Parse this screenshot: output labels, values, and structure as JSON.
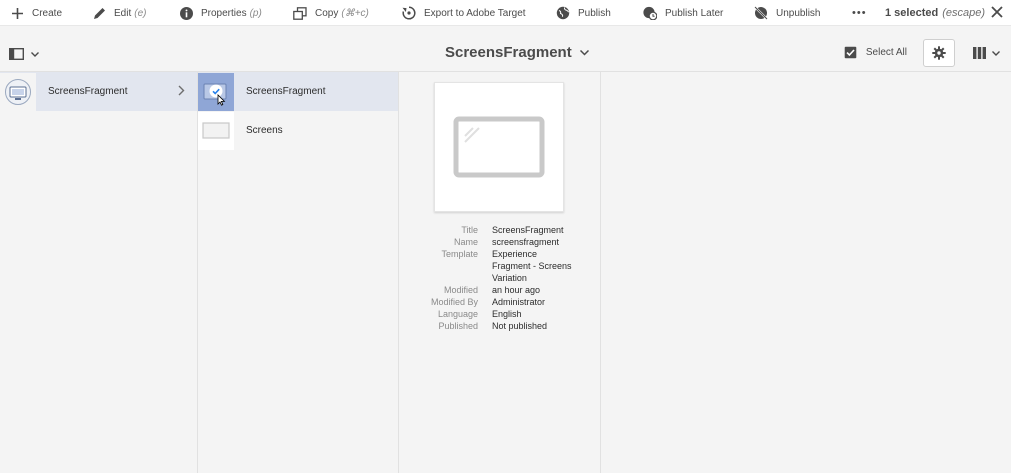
{
  "actionbar": {
    "create": "Create",
    "edit": "Edit",
    "edit_shortcut": "(e)",
    "properties": "Properties",
    "properties_shortcut": "(p)",
    "copy": "Copy",
    "copy_shortcut": "(⌘+c)",
    "export": "Export to Adobe Target",
    "publish": "Publish",
    "publish_later": "Publish Later",
    "unpublish": "Unpublish",
    "more": "•••",
    "selected": "1 selected",
    "escape": "(escape)"
  },
  "titlebar": {
    "title": "ScreensFragment",
    "select_all": "Select All"
  },
  "columns": {
    "col1": [
      {
        "label": "ScreensFragment"
      }
    ],
    "col2": [
      {
        "label": "ScreensFragment"
      },
      {
        "label": "Screens"
      }
    ]
  },
  "details": {
    "rows": [
      {
        "key": "Title",
        "value": "ScreensFragment"
      },
      {
        "key": "Name",
        "value": "screensfragment"
      },
      {
        "key": "Template",
        "value": "Experience"
      },
      {
        "key": "",
        "value": "Fragment - Screens"
      },
      {
        "key": "",
        "value": "Variation"
      },
      {
        "key": "Modified",
        "value": "an hour ago"
      },
      {
        "key": "Modified By",
        "value": "Administrator"
      },
      {
        "key": "Language",
        "value": "English"
      },
      {
        "key": "Published",
        "value": "Not published"
      }
    ]
  },
  "colors": {
    "accent": "#2680eb",
    "selected_thumb": "#8fa6d6",
    "row_active": "#e2e6ef"
  }
}
